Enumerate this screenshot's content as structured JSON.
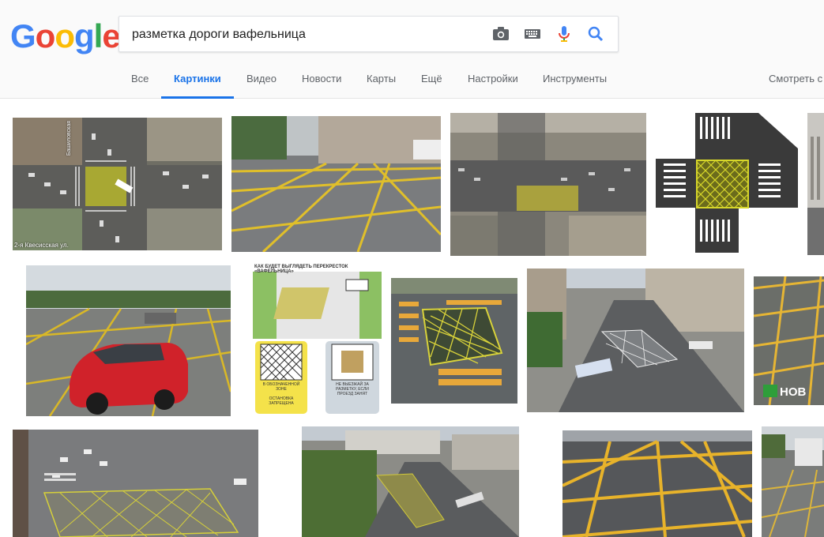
{
  "logo": {
    "text": "Google"
  },
  "search": {
    "query": "разметка дороги вафельница"
  },
  "colors": {
    "accent": "#1a73e8",
    "yellow_marking": "#e2c21b"
  },
  "tabs": [
    {
      "label": "Все"
    },
    {
      "label": "Картинки",
      "active": true
    },
    {
      "label": "Видео"
    },
    {
      "label": "Новости"
    },
    {
      "label": "Карты"
    },
    {
      "label": "Ещё"
    },
    {
      "label": "Настройки"
    },
    {
      "label": "Инструменты"
    }
  ],
  "safesearch": {
    "label": "Смотреть с"
  },
  "results": {
    "r1": {
      "caption": "2-я Квесисская ул.",
      "side_caption": "Башиловская"
    },
    "r6": {
      "title": "КАК БУДЕТ ВЫГЛЯДЕТЬ ПЕРЕКРЕСТОК «ВАФЕЛЬНИЦА»",
      "panel_left_1": "В ОБОЗНАЧЕННОЙ ЗОНЕ",
      "panel_left_2": "ОСТАНОВКА ЗАПРЕЩЕНА",
      "panel_right": "НЕ ВЫЕЗЖАЙ ЗА РАЗМЕТКУ, ЕСЛИ ПРОЕЗД ЗАНЯТ"
    },
    "r9": {
      "watermark": "НОВ"
    }
  }
}
